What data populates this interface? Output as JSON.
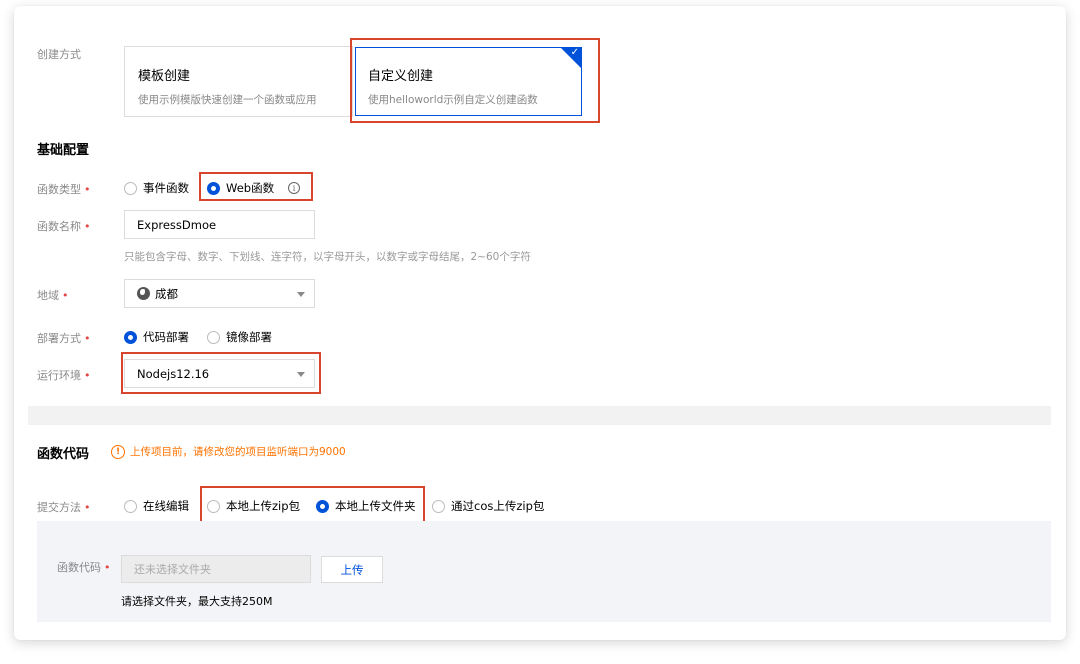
{
  "creation": {
    "label": "创建方式",
    "template": {
      "title": "模板创建",
      "desc": "使用示例模版快速创建一个函数或应用"
    },
    "custom": {
      "title": "自定义创建",
      "desc": "使用helloworld示例自定义创建函数",
      "selected": true
    }
  },
  "basic": {
    "title": "基础配置",
    "func_type": {
      "label": "函数类型",
      "options": [
        "事件函数",
        "Web函数"
      ],
      "selected": "Web函数"
    },
    "func_name": {
      "label": "函数名称",
      "value": "ExpressDmoe",
      "hint": "只能包含字母、数字、下划线、连字符，以字母开头，以数字或字母结尾，2~60个字符"
    },
    "region": {
      "label": "地域",
      "value": "成都"
    },
    "deploy": {
      "label": "部署方式",
      "options": [
        "代码部署",
        "镜像部署"
      ],
      "selected": "代码部署"
    },
    "runtime": {
      "label": "运行环境",
      "value": "Nodejs12.16"
    }
  },
  "code": {
    "title": "函数代码",
    "warning": "上传项目前，请修改您的项目监听端口为9000",
    "submit": {
      "label": "提交方法",
      "options": [
        "在线编辑",
        "本地上传zip包",
        "本地上传文件夹",
        "通过cos上传zip包"
      ],
      "selected": "本地上传文件夹"
    },
    "upload": {
      "label": "函数代码",
      "placeholder": "还未选择文件夹",
      "button": "上传",
      "hint": "请选择文件夹，最大支持250M"
    }
  },
  "colors": {
    "accent": "#0052d9",
    "highlight": "#d9442c",
    "warning": "#ff7200",
    "required": "#e54545"
  }
}
